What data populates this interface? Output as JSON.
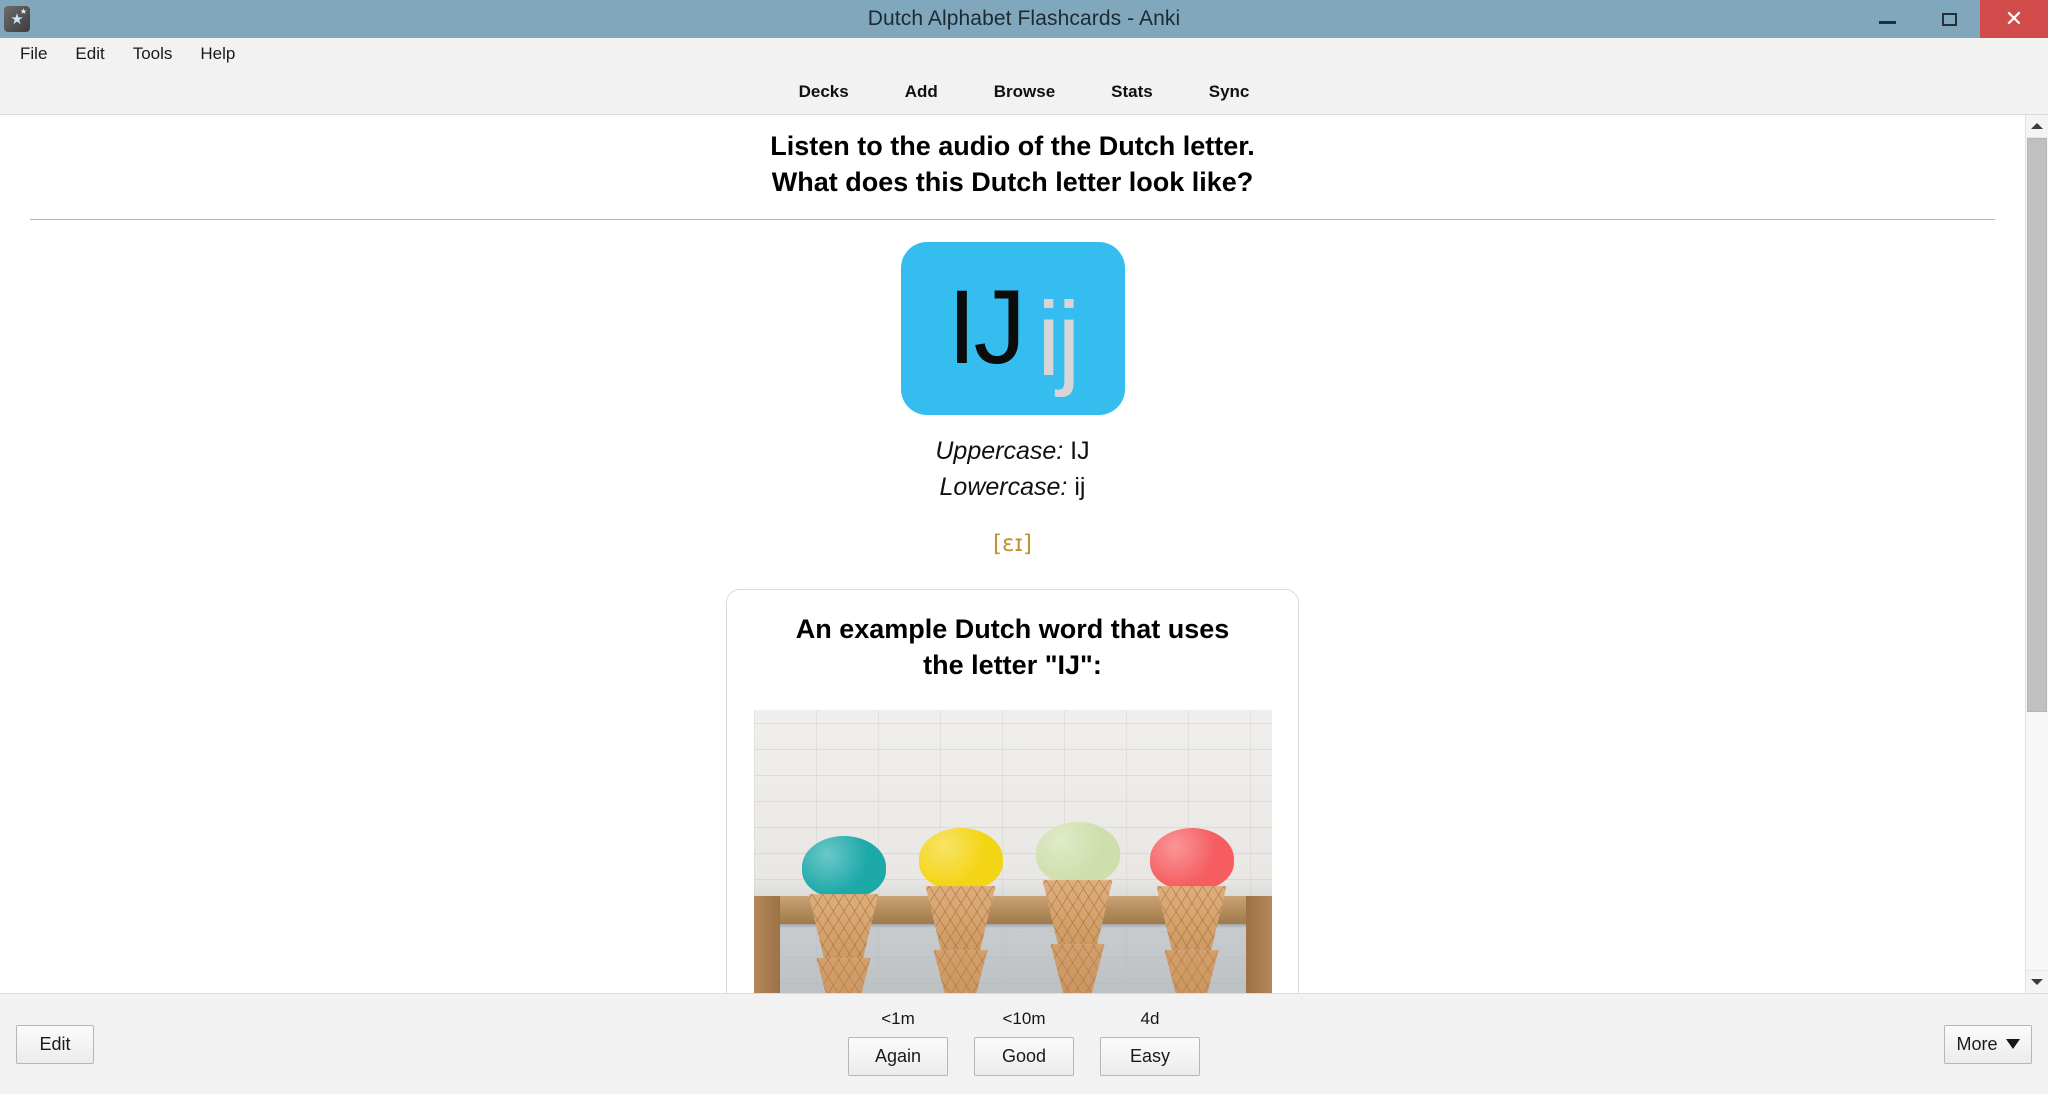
{
  "window": {
    "title": "Dutch Alphabet Flashcards - Anki",
    "app_icon": "anki-star-icon",
    "minimize_label": "Minimize",
    "maximize_label": "Restore",
    "close_label": "Close"
  },
  "menubar": {
    "items": [
      {
        "label": "File",
        "name": "menu-file"
      },
      {
        "label": "Edit",
        "name": "menu-edit"
      },
      {
        "label": "Tools",
        "name": "menu-tools"
      },
      {
        "label": "Help",
        "name": "menu-help"
      }
    ]
  },
  "toolbar": {
    "items": [
      {
        "label": "Decks"
      },
      {
        "label": "Add"
      },
      {
        "label": "Browse"
      },
      {
        "label": "Stats"
      },
      {
        "label": "Sync"
      }
    ]
  },
  "card": {
    "question_line1": "Listen to the audio of the Dutch letter.",
    "question_line2": "What does this Dutch letter look like?",
    "letter_tile": {
      "uppercase_glyph": "IJ",
      "lowercase_glyph": "ij",
      "background_color": "#36bdf0",
      "uppercase_color": "#0c0c0c",
      "lowercase_color": "#d6d6d6"
    },
    "uppercase_label": "Uppercase:",
    "uppercase_value": "IJ",
    "lowercase_label": "Lowercase:",
    "lowercase_value": "ij",
    "ipa": "[ɛɪ]",
    "ipa_color": "#bf9233",
    "example": {
      "title_line1": "An example Dutch word that uses",
      "title_line2": "the letter \"IJ\":",
      "image_alt": "four ice cream cones on a wooden stand",
      "scoop_colors": [
        "#23a8a8",
        "#f2d51e",
        "#cfdfae",
        "#f05f62"
      ]
    }
  },
  "bottombar": {
    "edit_label": "Edit",
    "more_label": "More",
    "more_icon": "chevron-down-icon",
    "answers": [
      {
        "interval": "<1m",
        "label": "Again"
      },
      {
        "interval": "<10m",
        "label": "Good"
      },
      {
        "interval": "4d",
        "label": "Easy"
      }
    ]
  },
  "scrollbar": {
    "up_icon": "chevron-up-icon",
    "down_icon": "chevron-down-icon"
  }
}
